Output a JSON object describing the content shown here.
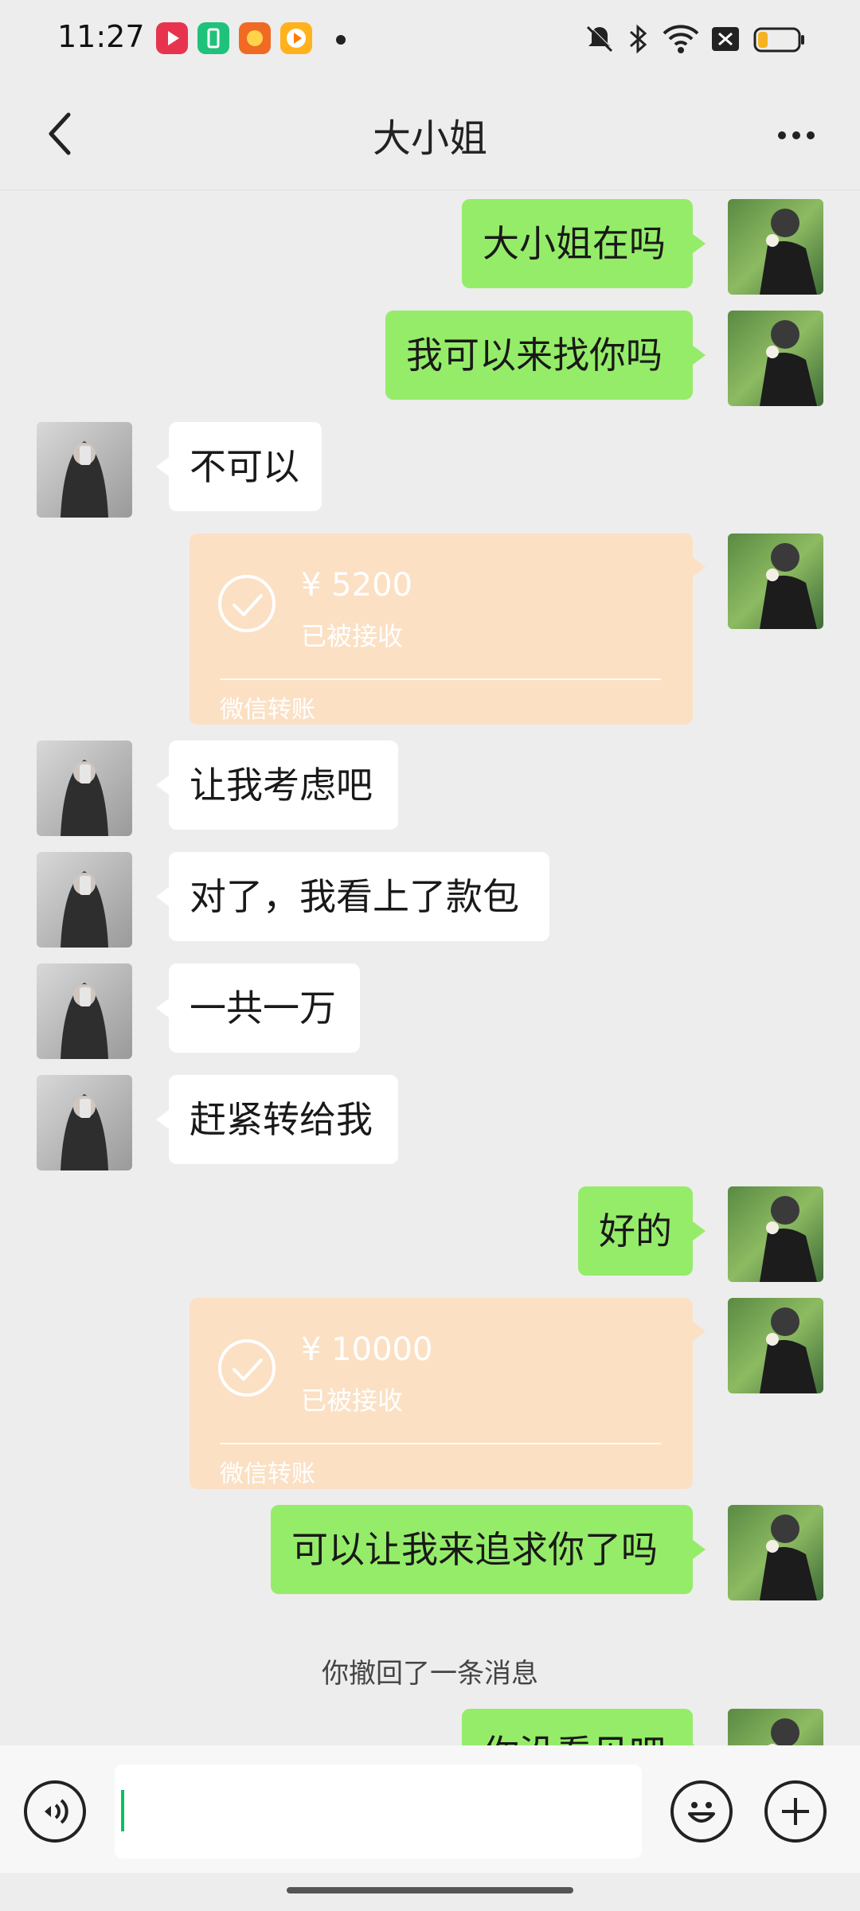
{
  "status_bar": {
    "time": "11:27",
    "icons": [
      "video-app-icon",
      "battery-saver-app-icon",
      "game-app-icon",
      "video-player-app-icon",
      "mute-icon",
      "bluetooth-icon",
      "wifi-icon",
      "sim-off-icon",
      "battery-icon"
    ]
  },
  "header": {
    "title": "大小姐",
    "back_icon": "chevron-left-icon",
    "more_icon": "more-icon"
  },
  "messages": [
    {
      "from": "me",
      "text": "大小姐在吗"
    },
    {
      "from": "me",
      "text": "我可以来找你吗"
    },
    {
      "from": "other",
      "text": "不可以"
    },
    {
      "from": "me",
      "type": "transfer",
      "amount": "¥ 5200",
      "status": "已被接收",
      "label": "微信转账"
    },
    {
      "from": "other",
      "text": "让我考虑吧"
    },
    {
      "from": "other",
      "text": "对了，我看上了款包"
    },
    {
      "from": "other",
      "text": "一共一万"
    },
    {
      "from": "other",
      "text": "赶紧转给我"
    },
    {
      "from": "me",
      "text": "好的"
    },
    {
      "from": "me",
      "type": "transfer",
      "amount": "¥ 10000",
      "status": "已被接收",
      "label": "微信转账"
    },
    {
      "from": "me",
      "text": "可以让我来追求你了吗"
    },
    {
      "type": "system",
      "text": "你撤回了一条消息"
    },
    {
      "from": "me",
      "text": "你没看见吧"
    }
  ],
  "input_bar": {
    "voice_icon": "voice-icon",
    "emoji_icon": "emoji-icon",
    "plus_icon": "plus-icon",
    "value": ""
  },
  "colors": {
    "background": "#ededed",
    "my_bubble": "#95ec69",
    "other_bubble": "#ffffff",
    "transfer_card": "#fbe0c4",
    "caret": "#07c160"
  }
}
